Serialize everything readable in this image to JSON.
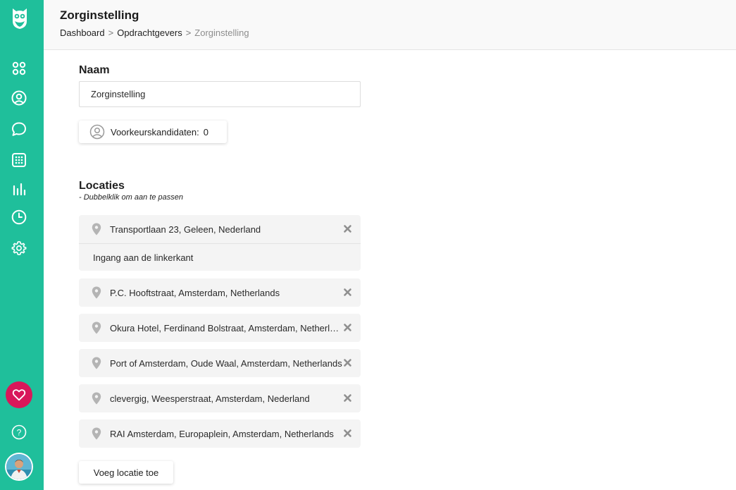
{
  "header": {
    "title": "Zorginstelling",
    "breadcrumb": {
      "dashboard": "Dashboard",
      "sep1": ">",
      "clients": "Opdrachtgevers",
      "sep2": ">",
      "current": "Zorginstelling"
    }
  },
  "sidebar": {
    "items": [
      {
        "icon": "dashboard-grid-icon"
      },
      {
        "icon": "user-circle-icon"
      },
      {
        "icon": "chat-bubble-icon"
      },
      {
        "icon": "calendar-grid-icon"
      },
      {
        "icon": "bar-chart-icon"
      },
      {
        "icon": "clock-icon"
      },
      {
        "icon": "gear-icon"
      }
    ],
    "favorite_icon": "heart-icon",
    "help_label": "?"
  },
  "form": {
    "name_label": "Naam",
    "name_value": "Zorginstelling",
    "preferred_label": "Voorkeurskandidaten:",
    "preferred_count": "0"
  },
  "locations": {
    "title": "Locaties",
    "hint": "- Dubbelklik om aan te passen",
    "items": [
      {
        "address": "Transportlaan 23, Geleen, Nederland",
        "note": "Ingang aan de linkerkant"
      },
      {
        "address": "P.C. Hooftstraat, Amsterdam, Netherlands"
      },
      {
        "address": "Okura Hotel, Ferdinand Bolstraat, Amsterdam, Netherlands"
      },
      {
        "address": "Port of Amsterdam, Oude Waal, Amsterdam, Netherlands"
      },
      {
        "address": "clevergig, Weesperstraat, Amsterdam, Nederland"
      },
      {
        "address": "RAI Amsterdam, Europaplein, Amsterdam, Netherlands"
      }
    ],
    "add_label": "Voeg locatie toe"
  },
  "colors": {
    "sidebar": "#1fbf9b",
    "favorite": "#d8175a"
  }
}
